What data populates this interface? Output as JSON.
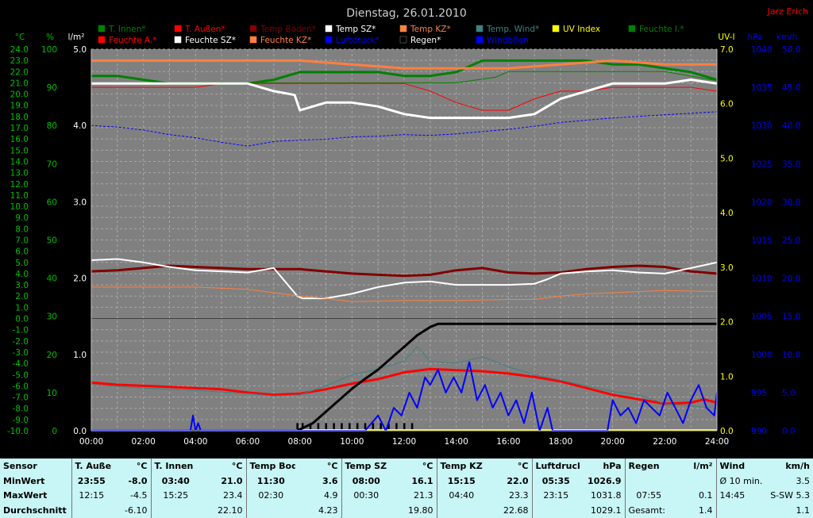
{
  "chart_data": {
    "type": "line",
    "title": "Dienstag, 26.01.2010",
    "author": "Jarz Erich",
    "x_ticks": [
      "00:00",
      "02:00",
      "04:00",
      "06:00",
      "08:00",
      "10:00",
      "12:00",
      "14:00",
      "16:00",
      "18:00",
      "20:00",
      "22:00",
      "24:00"
    ],
    "axes": {
      "temp_c": {
        "label": "°C",
        "range": [
          -10,
          24
        ],
        "color": "#00c000"
      },
      "humidity_pct": {
        "label": "%",
        "range": [
          0,
          100
        ],
        "color": "#00c000"
      },
      "rain_lm2": {
        "label": "l/m²",
        "range": [
          0,
          5
        ],
        "color": "#ffffff"
      },
      "uv": {
        "label": "UV-I",
        "range": [
          0,
          7
        ],
        "color": "#ffff00"
      },
      "pressure_hpa": {
        "label": "hPa",
        "range": [
          990,
          1040
        ],
        "color": "#0000ff"
      },
      "wind_kmh": {
        "label": "km/h",
        "range": [
          0,
          50
        ],
        "color": "#0000ff"
      }
    },
    "legend": [
      {
        "name": "T. Innen*",
        "color": "#008000"
      },
      {
        "name": "T. Außen*",
        "color": "#ff0000"
      },
      {
        "name": "Temp Boden*",
        "color": "#800000"
      },
      {
        "name": "Temp SZ*",
        "color": "#ffffff"
      },
      {
        "name": "Temp KZ*",
        "color": "#ff8040"
      },
      {
        "name": "Temp. Wind*",
        "color": "#408080"
      },
      {
        "name": "UV Index",
        "color": "#ffff00"
      },
      {
        "name": "Feuchte I.*",
        "color": "#008000"
      },
      {
        "name": "Feuchte A.*",
        "color": "#ff0000"
      },
      {
        "name": "Feuchte SZ*",
        "color": "#ffffff"
      },
      {
        "name": "Feuchte KZ*",
        "color": "#ff8040"
      },
      {
        "name": "Luftdruck*",
        "color": "#0000ff"
      },
      {
        "name": "Regen*",
        "color": "#000000"
      },
      {
        "name": "Windböen",
        "color": "#0000ff"
      }
    ],
    "series": [
      {
        "name": "T. Innen*",
        "axis": "temp_c",
        "color": "#008000",
        "width": 1,
        "x": [
          0,
          2,
          4,
          6,
          7,
          8,
          10,
          12,
          14,
          15.5,
          16,
          18,
          20,
          22,
          24
        ],
        "y": [
          21.0,
          21.0,
          21.0,
          21.0,
          21.0,
          21.0,
          21.0,
          21.0,
          21.0,
          21.5,
          22.0,
          22.0,
          22.0,
          22.0,
          21.2
        ]
      },
      {
        "name": "T. Außen*",
        "axis": "temp_c",
        "color": "#ff0000",
        "width": 3,
        "x": [
          0,
          1,
          2,
          3,
          4,
          5,
          6,
          7,
          8,
          9,
          10,
          11,
          12,
          13,
          14,
          15,
          16,
          17,
          18,
          19,
          20,
          21,
          22,
          23,
          23.5,
          24
        ],
        "y": [
          -5.7,
          -5.9,
          -6.0,
          -6.1,
          -6.2,
          -6.3,
          -6.6,
          -6.8,
          -6.7,
          -6.3,
          -5.8,
          -5.4,
          -4.8,
          -4.5,
          -4.6,
          -4.7,
          -4.9,
          -5.2,
          -5.6,
          -6.2,
          -6.8,
          -7.2,
          -7.6,
          -7.5,
          -7.2,
          -7.5
        ]
      },
      {
        "name": "Temp Boden*",
        "axis": "temp_c",
        "color": "#800000",
        "width": 3,
        "x": [
          0,
          1,
          2,
          3,
          4,
          5,
          6,
          7,
          8,
          9,
          10,
          11,
          12,
          13,
          14,
          15,
          16,
          17,
          18,
          19,
          20,
          21,
          22,
          23,
          24
        ],
        "y": [
          4.2,
          4.3,
          4.5,
          4.7,
          4.6,
          4.5,
          4.4,
          4.4,
          4.4,
          4.2,
          4.0,
          3.9,
          3.8,
          3.9,
          4.3,
          4.5,
          4.1,
          4.0,
          4.1,
          4.4,
          4.6,
          4.7,
          4.6,
          4.2,
          4.0
        ]
      },
      {
        "name": "Temp SZ*",
        "axis": "temp_c",
        "color": "#ffffff",
        "width": 2,
        "x": [
          0,
          1,
          2,
          3,
          4,
          5,
          6,
          7,
          7.9,
          8.1,
          9,
          10,
          11,
          12,
          13,
          14,
          15,
          16,
          17,
          17.5,
          18,
          19,
          20,
          21,
          22,
          23,
          24
        ],
        "y": [
          5.2,
          5.3,
          5.0,
          4.6,
          4.3,
          4.2,
          4.1,
          4.5,
          2.0,
          1.8,
          1.8,
          2.2,
          2.8,
          3.2,
          3.3,
          3.0,
          3.0,
          3.0,
          3.1,
          3.5,
          4.0,
          4.2,
          4.3,
          4.1,
          4.0,
          4.5,
          5.0
        ]
      },
      {
        "name": "Temp KZ*",
        "axis": "temp_c",
        "color": "#ff8040",
        "width": 1,
        "x": [
          0,
          2,
          4,
          6,
          7,
          8,
          9,
          10,
          12,
          14,
          16,
          17,
          18,
          19,
          20,
          22,
          24
        ],
        "y": [
          2.8,
          2.8,
          2.8,
          2.6,
          2.3,
          2.0,
          1.8,
          1.5,
          1.6,
          1.6,
          1.7,
          1.7,
          2.0,
          2.2,
          2.3,
          2.5,
          2.4
        ]
      },
      {
        "name": "Temp. Wind*",
        "axis": "temp_c",
        "color": "#408080",
        "width": 1,
        "x": [
          0,
          2,
          4,
          6,
          7,
          8,
          9,
          10,
          11,
          12,
          12.5,
          13,
          14,
          15,
          16,
          17,
          18,
          20,
          21,
          22,
          23,
          24
        ],
        "y": [
          -5.9,
          -6.2,
          -6.4,
          -6.7,
          -6.9,
          -6.8,
          -6.0,
          -5.0,
          -4.5,
          -3.8,
          -2.5,
          -3.8,
          -4.0,
          -3.4,
          -4.3,
          -5.0,
          -5.5,
          -6.5,
          -6.8,
          -7.6,
          -7.8,
          -8.0
        ]
      },
      {
        "name": "Feuchte I.*",
        "axis": "humidity_pct",
        "color": "#008000",
        "width": 3,
        "x": [
          0,
          1,
          2,
          3,
          4,
          5,
          6,
          7,
          8,
          9,
          10,
          11,
          12,
          13,
          14,
          15,
          16,
          17,
          18,
          19,
          20,
          21,
          22,
          23,
          24
        ],
        "y": [
          93,
          93,
          92,
          91,
          91,
          91,
          91,
          92,
          94,
          94,
          94,
          94,
          93,
          93,
          94,
          97,
          97,
          97,
          97,
          97,
          96,
          96,
          95,
          94,
          92
        ]
      },
      {
        "name": "Feuchte A.*",
        "axis": "humidity_pct",
        "color": "#ff0000",
        "width": 1,
        "x": [
          0,
          1,
          2,
          3,
          4,
          5,
          6,
          7,
          8,
          9,
          10,
          11,
          12,
          13,
          14,
          15,
          16,
          17,
          18,
          19,
          20,
          21,
          22,
          23,
          24
        ],
        "y": [
          90,
          90,
          90,
          90,
          90,
          91,
          91,
          91,
          91,
          91,
          91,
          91,
          91,
          89,
          86,
          84,
          84,
          87,
          89,
          89,
          90,
          90,
          90,
          90,
          89
        ]
      },
      {
        "name": "Feuchte SZ*",
        "axis": "humidity_pct",
        "color": "#ffffff",
        "width": 3,
        "x": [
          0,
          1,
          2,
          3,
          4,
          5,
          6,
          7,
          7.8,
          8,
          9,
          10,
          11,
          12,
          13,
          14,
          15,
          16,
          17,
          18,
          19,
          20,
          21,
          22,
          23,
          24
        ],
        "y": [
          91,
          91,
          91,
          91,
          91,
          91,
          91,
          89,
          88,
          84,
          86,
          86,
          85,
          83,
          82,
          82,
          82,
          82,
          83,
          87,
          89,
          91,
          91,
          91,
          92,
          91
        ]
      },
      {
        "name": "Feuchte KZ*",
        "axis": "humidity_pct",
        "color": "#ff8040",
        "width": 3,
        "x": [
          0,
          2,
          4,
          6,
          7,
          8,
          10,
          12,
          14,
          15,
          16,
          18,
          20,
          22,
          24
        ],
        "y": [
          97,
          97,
          97,
          97,
          97,
          97,
          96,
          95,
          95,
          95,
          95,
          96,
          97,
          96,
          96
        ]
      },
      {
        "name": "Luftdruck*",
        "axis": "pressure_hpa",
        "color": "#0000ff",
        "width": 1,
        "dashed": true,
        "x": [
          0,
          1,
          2,
          3,
          4,
          5,
          6,
          7,
          8,
          9,
          10,
          11,
          12,
          13,
          14,
          15,
          16,
          17,
          18,
          19,
          20,
          21,
          22,
          23,
          24
        ],
        "y": [
          1030.0,
          1029.8,
          1029.4,
          1028.8,
          1028.4,
          1027.8,
          1027.3,
          1027.9,
          1028.1,
          1028.2,
          1028.5,
          1028.6,
          1028.8,
          1028.7,
          1028.9,
          1029.2,
          1029.5,
          1029.9,
          1030.4,
          1030.7,
          1031.0,
          1031.2,
          1031.4,
          1031.6,
          1031.8
        ]
      },
      {
        "name": "Regen*",
        "axis": "rain_lm2",
        "color": "#000000",
        "width": 3,
        "x": [
          0,
          7.9,
          8.5,
          9,
          9.5,
          10,
          10.5,
          11,
          11.5,
          12,
          12.5,
          13,
          13.3,
          14,
          16,
          18,
          20,
          22,
          24
        ],
        "y": [
          0,
          0,
          0.1,
          0.25,
          0.4,
          0.55,
          0.68,
          0.8,
          0.95,
          1.1,
          1.25,
          1.36,
          1.4,
          1.4,
          1.4,
          1.4,
          1.4,
          1.4,
          1.4
        ]
      },
      {
        "name": "Windböen",
        "axis": "wind_kmh",
        "color": "#0000ff",
        "width": 2,
        "x": [
          0,
          3.8,
          3.9,
          4.0,
          4.1,
          4.2,
          10.5,
          11.0,
          11.3,
          11.6,
          11.9,
          12.2,
          12.5,
          12.8,
          13.0,
          13.3,
          13.6,
          13.9,
          14.2,
          14.5,
          14.8,
          15.1,
          15.4,
          15.7,
          16.0,
          16.3,
          16.6,
          16.9,
          17.2,
          17.5,
          17.7,
          19.8,
          20.0,
          20.3,
          20.6,
          20.9,
          21.2,
          21.5,
          21.8,
          22.1,
          22.4,
          22.7,
          23.0,
          23.3,
          23.6,
          23.9,
          24
        ],
        "y": [
          0,
          0,
          2,
          0,
          1,
          0,
          0,
          2,
          0,
          3,
          2,
          5,
          3,
          7,
          6,
          8,
          5,
          7,
          5,
          9,
          4,
          6,
          3,
          5,
          2,
          4,
          1,
          5,
          0,
          3,
          0,
          0,
          4,
          2,
          3,
          1,
          4,
          3,
          2,
          5,
          3,
          1,
          4,
          6,
          3,
          2,
          5
        ]
      }
    ],
    "rain_bars": {
      "axis": "rain_lm2",
      "x": [
        7.9,
        8.1,
        8.4,
        8.7,
        9.0,
        9.3,
        9.6,
        9.9,
        10.2,
        10.5,
        10.8,
        11.1,
        11.4,
        11.7,
        12.0,
        12.3
      ],
      "y": [
        0.1,
        0.1,
        0.1,
        0.1,
        0.1,
        0.1,
        0.1,
        0.1,
        0.1,
        0.1,
        0.1,
        0.1,
        0.1,
        0.1,
        0.1,
        0.1
      ]
    },
    "uv": {
      "axis": "uv",
      "x": [
        0,
        24
      ],
      "y": [
        0,
        0
      ]
    }
  },
  "stats": {
    "row_labels": {
      "sensor": "Sensor",
      "min": "MinWert",
      "max": "MaxWert",
      "avg": "Durchschnitt"
    },
    "groups": [
      {
        "name": "T. Außen",
        "unit": "°C",
        "min_time": "23:55",
        "min_val": "-8.0",
        "max_time": "12:15",
        "max_val": "-4.5",
        "avg": "-6.10"
      },
      {
        "name": "T. Innen",
        "unit": "°C",
        "min_time": "03:40",
        "min_val": "21.0",
        "max_time": "15:25",
        "max_val": "23.4",
        "avg": "22.10"
      },
      {
        "name": "Temp Boden",
        "unit": "°C",
        "min_time": "11:30",
        "min_val": "3.6",
        "max_time": "02:30",
        "max_val": "4.9",
        "avg": "4.23"
      },
      {
        "name": "Temp SZ",
        "unit": "°C",
        "min_time": "08:00",
        "min_val": "16.1",
        "max_time": "00:30",
        "max_val": "21.3",
        "avg": "19.80"
      },
      {
        "name": "Temp KZ",
        "unit": "°C",
        "min_time": "15:15",
        "min_val": "22.0",
        "max_time": "04:40",
        "max_val": "23.3",
        "avg": "22.68"
      },
      {
        "name": "Luftdruck",
        "unit": "hPa",
        "min_time": "05:35",
        "min_val": "1026.9",
        "max_time": "23:15",
        "max_val": "1031.8",
        "avg": "1029.1"
      },
      {
        "name": "Regen",
        "unit": "l/m²",
        "min_time": "",
        "min_val": "",
        "max_time": "07:55",
        "max_val": "0.1",
        "avg_label": "Gesamt:",
        "avg": "1.4"
      },
      {
        "name": "Wind",
        "unit": "km/h",
        "min_time": "Ø 10 min.",
        "min_val": "3.5",
        "max_time": "14:45",
        "max_dir": "S-SW",
        "max_val": "5.3",
        "avg": "1.1"
      }
    ]
  }
}
